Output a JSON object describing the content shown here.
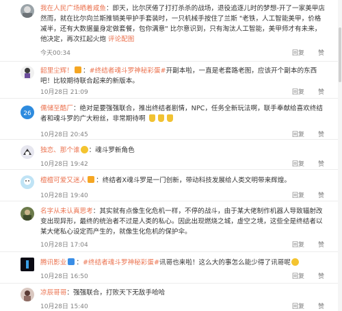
{
  "comments": [
    {
      "user": "我在人民广场晒着咸鱼",
      "text": "：即天，比尔厌倦了打打杀杀的战场，退役追逐儿时的梦想-开了一家美甲店 然而，就在比尔向兰斯推销美甲护手套装时，一只机械手按住了兰斯 \"老铁，人工智能美甲，价格减半，还有大数据量身定做套餐，包你满意\" 比尔意识到，只有淘汰人工智能，美甲师才有未来，他决定，再次扛起火炮",
      "more": "评论配图",
      "time": "今天00:34",
      "reply": "回复",
      "like": "赞"
    },
    {
      "user": "韶里尘辉！",
      "topic": "#终结者魂斗罗神秘彩蛋#",
      "text": "开副本啦，一直是老套路老图，应该开个副本的东西吧！比较期待联合起来的新版本。",
      "time": "10月28日 21:09",
      "reply": "回复",
      "like": "赞"
    },
    {
      "user": "儒储至酷厂",
      "text": "：绝对是要强强联合，推出终结者剧情，NPC，任务全新玩法啊，联手奉献给喜欢终结者和魂斗罗的广大粉丝，非常期待啊",
      "time": "10月28日 20:45",
      "reply": "回复",
      "like": "赞"
    },
    {
      "user": "独恋、那个谁",
      "text": "：魂斗罗新角色",
      "time": "10月28日 19:42",
      "reply": "回复",
      "like": "赞"
    },
    {
      "user": "檀檀可爱又迷人",
      "text": "：终结者X魂斗罗是一门创新，带动科技发展给人类文明带来辉煌。",
      "time": "10月28日 19:40",
      "reply": "回复",
      "like": "赞"
    },
    {
      "user": "名字从未认真思考",
      "text": "：其实就有点像生化危机一样，不停的战斗，由于某大佬制作机器人导致辐射改变出现异形，最终的统治者不过是人类的私心。因此出现燃烧之城，虚空之境，这些全是终结者以某大佬私心设定而产生的，就像生化危机的保护伞。",
      "time": "10月28日 17:04",
      "reply": "回复",
      "like": "赞"
    },
    {
      "user": "腾讯影业",
      "topic": "#终结者魂斗罗神秘彩蛋#",
      "text": "讯哥也来啦！这么大的事怎么能少得了讯哥呢",
      "time": "10月28日 16:50",
      "reply": "回复",
      "like": "赞"
    },
    {
      "user": "凉辰哥哥",
      "text": "：强强联合，打败天下无敌手哈哈",
      "time": "10月28日 15:40",
      "reply": "回复",
      "like": "赞"
    }
  ]
}
